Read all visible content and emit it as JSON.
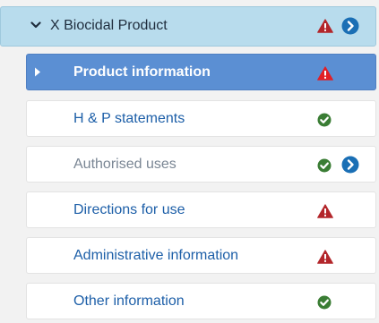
{
  "colors": {
    "header_bg": "#b8dced",
    "active_bg": "#5b8fd3",
    "link_text": "#1d5fa8",
    "muted_text": "#7a8694",
    "warning": "#b3262b",
    "warning_active": "#e21f26",
    "ok": "#3a7d34",
    "go": "#1a6fb5"
  },
  "tree": {
    "root": {
      "label": "X Biocidal Product",
      "expand_icon": "chevron-down-icon",
      "status_icon": "warning-triangle-icon",
      "action_icon": "circle-arrow-right-icon"
    },
    "items": [
      {
        "label": "Product information",
        "status": "warning",
        "active": true,
        "has_action": false
      },
      {
        "label": "H & P statements",
        "status": "ok",
        "active": false,
        "has_action": false
      },
      {
        "label": "Authorised uses",
        "status": "ok",
        "active": false,
        "has_action": true,
        "muted": true
      },
      {
        "label": "Directions for use",
        "status": "warning",
        "active": false,
        "has_action": false
      },
      {
        "label": "Administrative information",
        "status": "warning",
        "active": false,
        "has_action": false
      },
      {
        "label": "Other information",
        "status": "ok",
        "active": false,
        "has_action": false
      }
    ]
  }
}
